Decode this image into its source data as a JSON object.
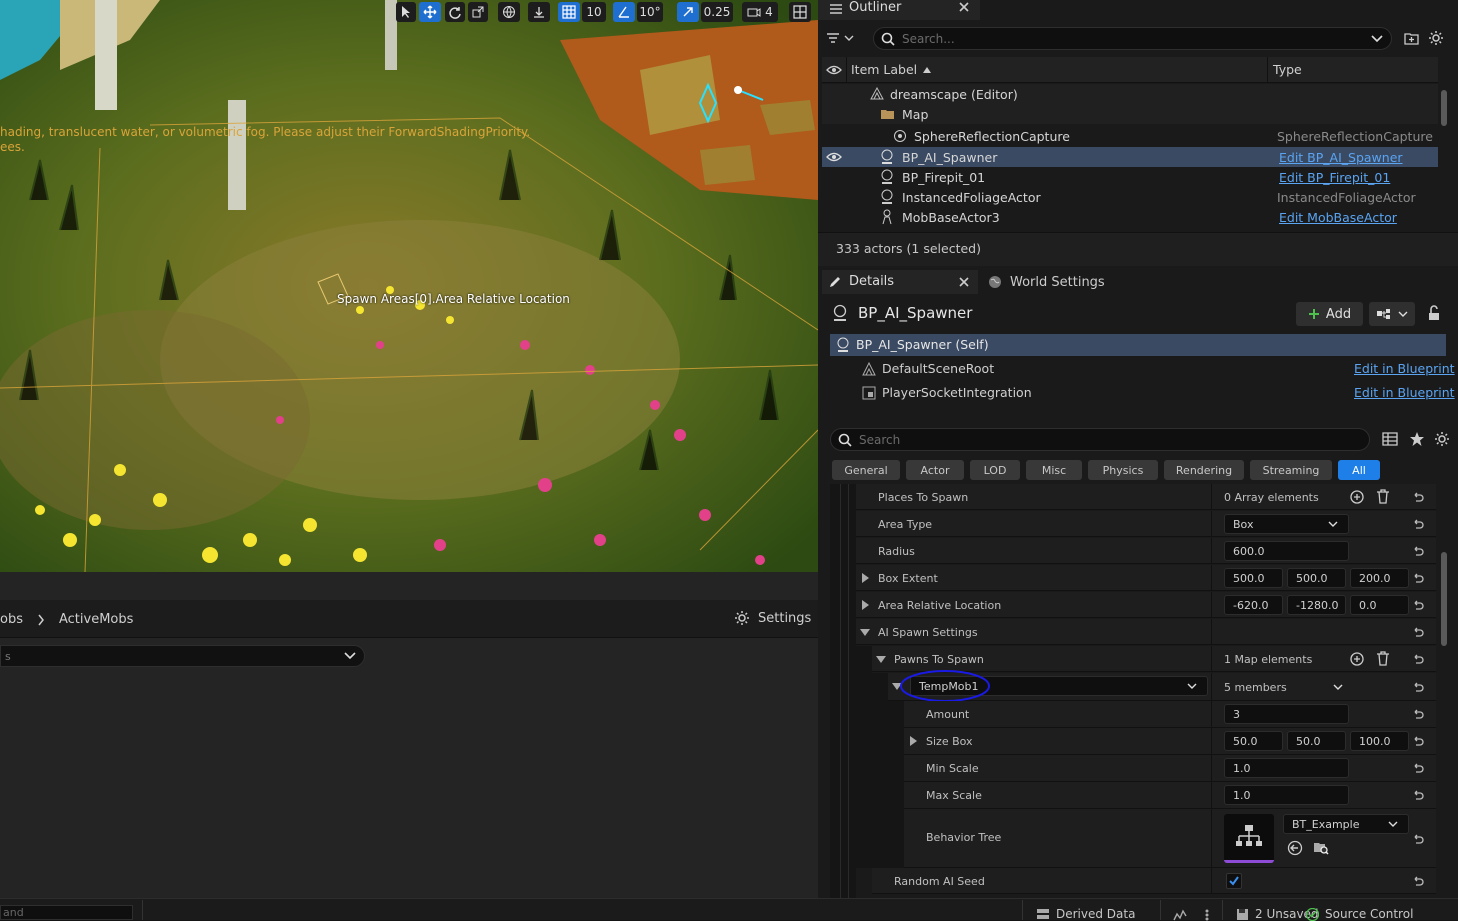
{
  "viewport": {
    "toolbar": {
      "grid_snap": "10",
      "rotation_snap": "10°",
      "scale_snap": "0.25",
      "camera_speed": "4"
    },
    "warning_text": "hading, translucent water, or volumetric fog. Please adjust their ForwardShadingPriority.",
    "warning_text_2": "ees.",
    "widget_label": "Spawn Areas[0].Area Relative Location"
  },
  "content_browser": {
    "breadcrumb": [
      "obs",
      "ActiveMobs"
    ],
    "settings_label": "Settings",
    "filter_placeholder": "s"
  },
  "outliner": {
    "tab_title": "Outliner",
    "search_placeholder": "Search...",
    "col_label": "Item Label",
    "col_type": "Type",
    "rows": [
      {
        "label": "dreamscape (Editor)",
        "type": ""
      },
      {
        "label": "Map",
        "type": ""
      },
      {
        "label": "SphereReflectionCapture",
        "type": "SphereReflectionCapture"
      },
      {
        "label": "BP_AI_Spawner",
        "type": "Edit BP_AI_Spawner"
      },
      {
        "label": "BP_Firepit_01",
        "type": "Edit BP_Firepit_01"
      },
      {
        "label": "InstancedFoliageActor",
        "type": "InstancedFoliageActor"
      },
      {
        "label": "MobBaseActor3",
        "type": "Edit MobBaseActor"
      }
    ],
    "status": "333 actors (1 selected)"
  },
  "details": {
    "tab_title": "Details",
    "world_tab": "World Settings",
    "actor_name": "BP_AI_Spawner",
    "add_label": "Add",
    "components": [
      {
        "label": "BP_AI_Spawner (Self)",
        "link": ""
      },
      {
        "label": "DefaultSceneRoot",
        "link": "Edit in Blueprint"
      },
      {
        "label": "PlayerSocketIntegration",
        "link": "Edit in Blueprint"
      }
    ],
    "search_placeholder": "Search",
    "filters": [
      "General",
      "Actor",
      "LOD",
      "Misc",
      "Physics",
      "Rendering",
      "Streaming",
      "All"
    ],
    "props": {
      "places_to_spawn": {
        "label": "Places To Spawn",
        "value": "0 Array elements"
      },
      "area_type": {
        "label": "Area Type",
        "value": "Box"
      },
      "radius": {
        "label": "Radius",
        "value": "600.0"
      },
      "box_extent": {
        "label": "Box Extent",
        "x": "500.0",
        "y": "500.0",
        "z": "200.0"
      },
      "area_rel_loc": {
        "label": "Area Relative Location",
        "x": "-620.0",
        "y": "-1280.0",
        "z": "0.0"
      },
      "ai_spawn_settings": {
        "label": "AI Spawn Settings"
      },
      "pawns_to_spawn": {
        "label": "Pawns To Spawn",
        "value": "1 Map elements"
      },
      "temp_mob": {
        "key": "TempMob1",
        "value": "5 members"
      },
      "amount": {
        "label": "Amount",
        "value": "3"
      },
      "size_box": {
        "label": "Size Box",
        "x": "50.0",
        "y": "50.0",
        "z": "100.0"
      },
      "min_scale": {
        "label": "Min Scale",
        "value": "1.0"
      },
      "max_scale": {
        "label": "Max Scale",
        "value": "1.0"
      },
      "behavior_tree": {
        "label": "Behavior Tree",
        "value": "BT_Example"
      },
      "random_ai_seed": {
        "label": "Random AI Seed",
        "checked": true
      }
    }
  },
  "statusbar": {
    "cmd_placeholder": "and",
    "derived_data": "Derived Data",
    "unsaved": "2 Unsaved",
    "source_control": "Source Control"
  },
  "colors": {
    "accent": "#1f7fe8",
    "selection": "#3a4a63",
    "link": "#5aa4f2",
    "warning": "#d9a43a"
  }
}
